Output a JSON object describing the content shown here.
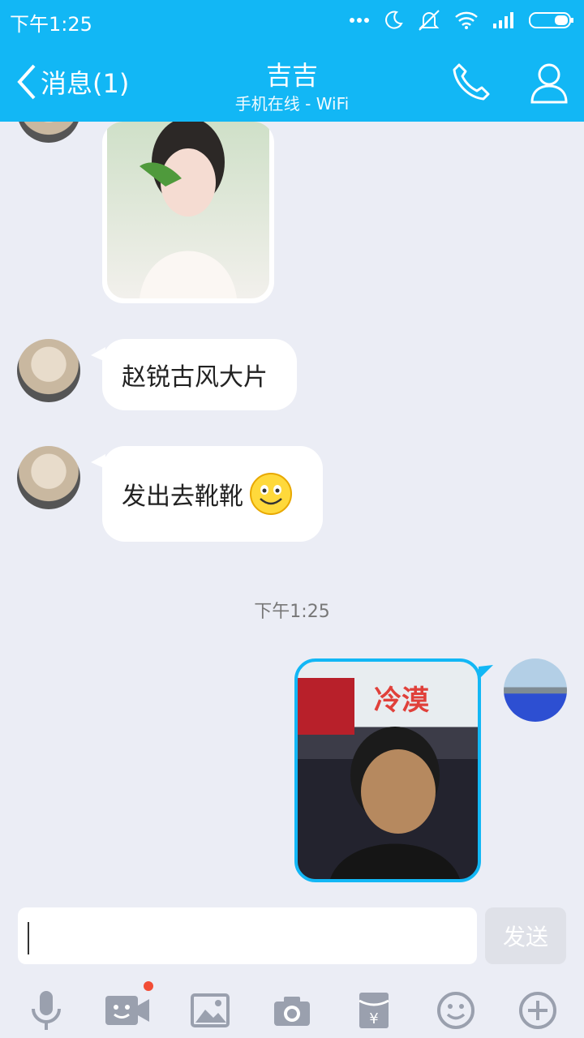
{
  "status_bar": {
    "time": "下午1:25"
  },
  "header": {
    "back_label": "消息(1)",
    "title": "吉吉",
    "subtitle": "手机在线 - WiFi"
  },
  "messages": [
    {
      "type": "image",
      "sender": "contact"
    },
    {
      "type": "text",
      "sender": "contact",
      "text": "赵锐古风大片"
    },
    {
      "type": "text",
      "sender": "contact",
      "text": "发出去靴靴",
      "emoji": "smile-emoji"
    },
    {
      "type": "timestamp",
      "text": "下午1:25"
    },
    {
      "type": "image",
      "sender": "me",
      "caption": "冷漠"
    }
  ],
  "composer": {
    "input_value": "",
    "send_label": "发送"
  },
  "toolbar": {
    "items": [
      "microphone-icon",
      "video-icon",
      "image-icon",
      "camera-icon",
      "red-packet-icon",
      "emoji-icon",
      "plus-icon"
    ]
  },
  "colors": {
    "accent": "#12B7F5",
    "background": "#EBEDF5",
    "badge": "#F24D36"
  }
}
